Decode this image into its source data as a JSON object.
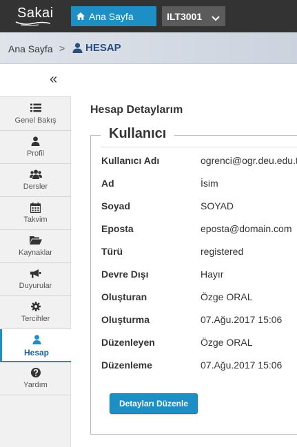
{
  "header": {
    "logo_text": "Sakai",
    "home_label": "Ana Sayfa",
    "site_label": "ILT3001"
  },
  "breadcrumb": {
    "home": "Ana Sayfa",
    "separator": ">",
    "current": "HESAP"
  },
  "toolmenu": {
    "collapse_glyph": "«",
    "items": [
      {
        "label": "Genel Bakış",
        "icon": "list-icon"
      },
      {
        "label": "Profil",
        "icon": "user-icon"
      },
      {
        "label": "Dersler",
        "icon": "users-icon"
      },
      {
        "label": "Takvim",
        "icon": "calendar-icon"
      },
      {
        "label": "Kaynaklar",
        "icon": "folder-icon"
      },
      {
        "label": "Duyurular",
        "icon": "bullhorn-icon"
      },
      {
        "label": "Tercihler",
        "icon": "gear-icon"
      },
      {
        "label": "Hesap",
        "icon": "user-icon"
      },
      {
        "label": "Yardım",
        "icon": "question-icon"
      }
    ],
    "active_index": 7
  },
  "main": {
    "title": "Hesap Detaylarım",
    "legend": "Kullanıcı",
    "fields": [
      {
        "key": "Kullanıcı Adı",
        "value": "ogrenci@ogr.deu.edu.tr"
      },
      {
        "key": "Ad",
        "value": "İsim"
      },
      {
        "key": "Soyad",
        "value": "SOYAD"
      },
      {
        "key": "Eposta",
        "value": "eposta@domain.com"
      },
      {
        "key": "Türü",
        "value": "registered"
      },
      {
        "key": "Devre Dışı",
        "value": "Hayır"
      },
      {
        "key": "Oluşturan",
        "value": "Özge ORAL"
      },
      {
        "key": "Oluşturma",
        "value": "07.Ağu.2017 15:06"
      },
      {
        "key": "Düzenleyen",
        "value": "Özge ORAL"
      },
      {
        "key": "Düzenleme",
        "value": "07.Ağu.2017 15:06"
      }
    ],
    "edit_button": "Detayları Düzenle"
  },
  "colors": {
    "accent": "#1d8fc5",
    "topbar": "#333333",
    "crumb_text": "#2a4f7c"
  }
}
